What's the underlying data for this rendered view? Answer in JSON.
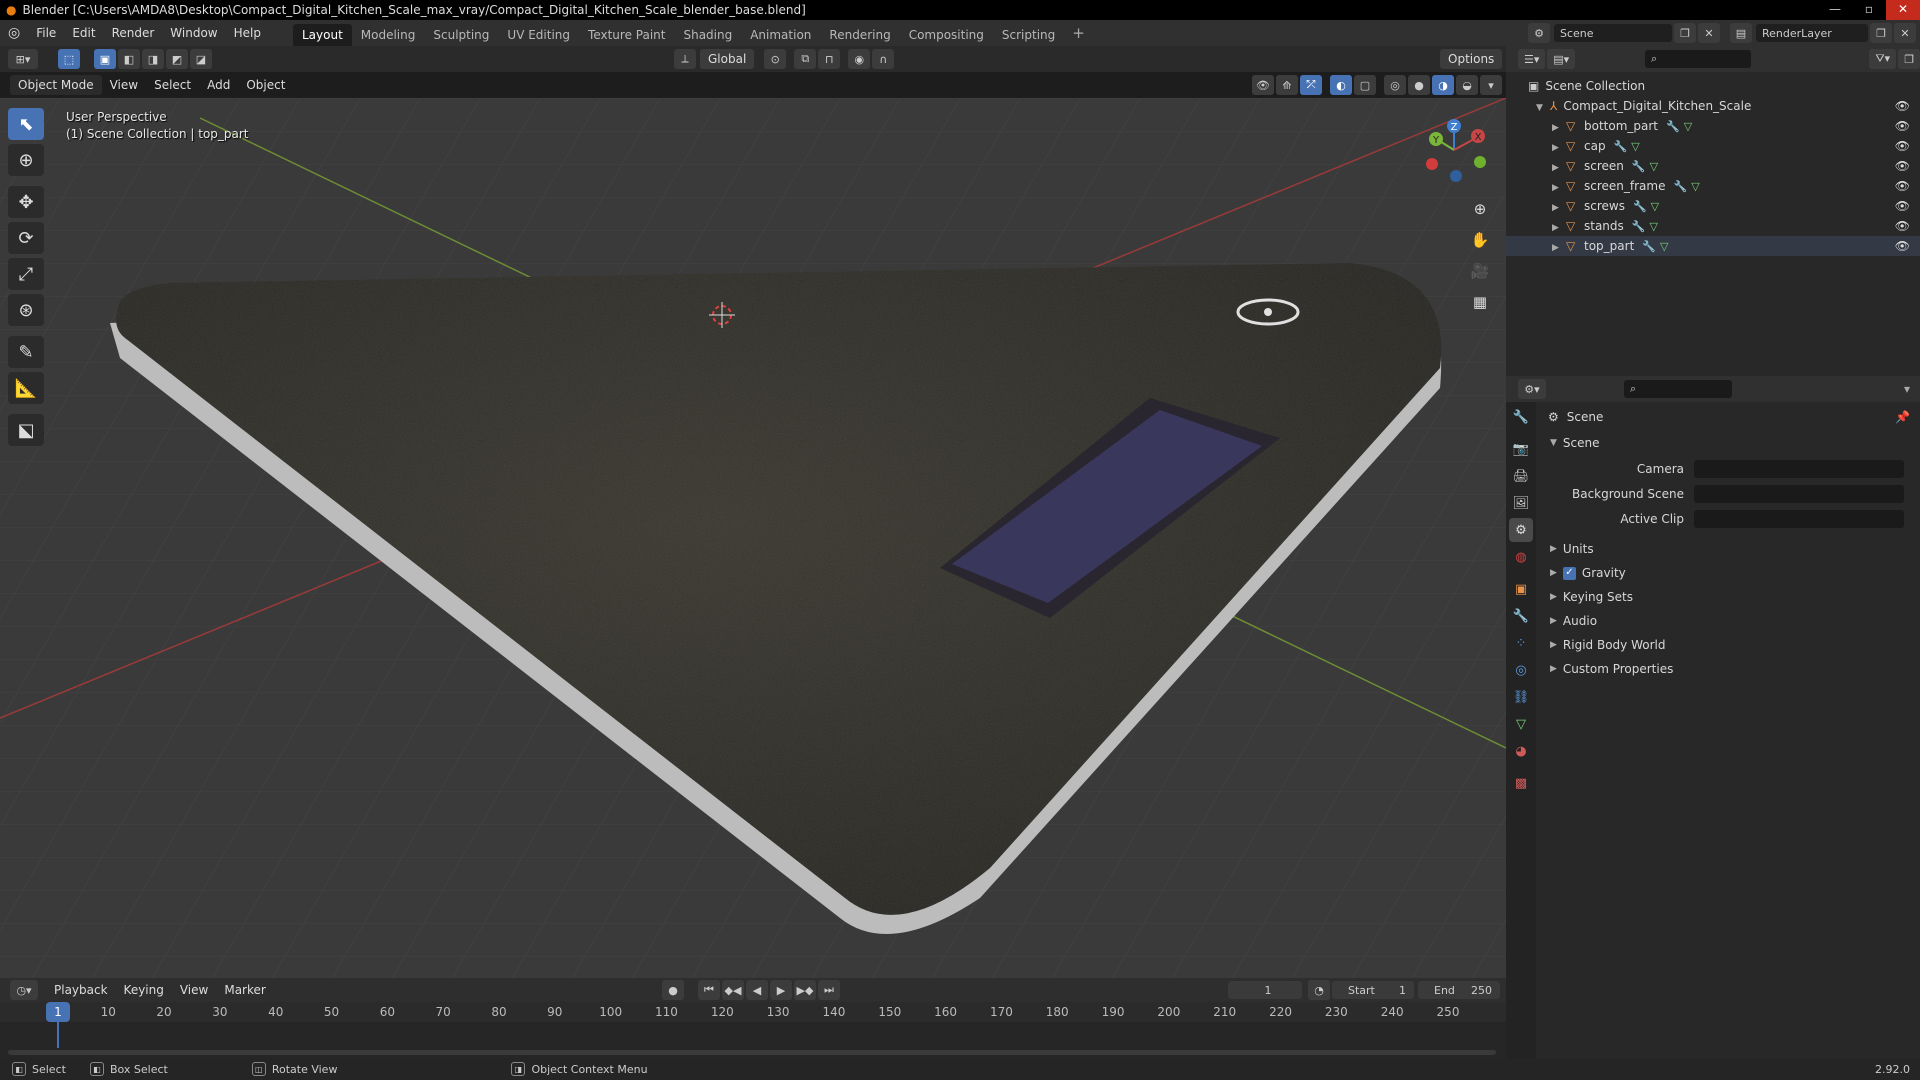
{
  "window": {
    "title": "Blender [C:\\Users\\AMDA8\\Desktop\\Compact_Digital_Kitchen_Scale_max_vray/Compact_Digital_Kitchen_Scale_blender_base.blend]",
    "minimize": "—",
    "maximize": "▫",
    "close": "✕"
  },
  "menu": [
    "File",
    "Edit",
    "Render",
    "Window",
    "Help"
  ],
  "workspaces": [
    "Layout",
    "Modeling",
    "Sculpting",
    "UV Editing",
    "Texture Paint",
    "Shading",
    "Animation",
    "Rendering",
    "Compositing",
    "Scripting"
  ],
  "workspace_add": "+",
  "active_workspace": "Layout",
  "scene_selector": {
    "value": "Scene"
  },
  "renderlayer_selector": {
    "value": "RenderLayer"
  },
  "viewport_header": {
    "transform_orientation": "Global",
    "options": "Options"
  },
  "viewport_menu": {
    "mode": "Object Mode",
    "items": [
      "View",
      "Select",
      "Add",
      "Object"
    ]
  },
  "viewport_overlay": {
    "line1": "User Perspective",
    "line2": "(1) Scene Collection | top_part"
  },
  "gizmo": {
    "x": "X",
    "y": "Y",
    "z": "Z"
  },
  "outliner": {
    "root": "Scene Collection",
    "collection": "Compact_Digital_Kitchen_Scale",
    "objects": [
      "bottom_part",
      "cap",
      "screen",
      "screen_frame",
      "screws",
      "stands",
      "top_part"
    ]
  },
  "properties": {
    "context": "Scene",
    "panel_title": "Scene",
    "fields": [
      {
        "label": "Camera",
        "value": ""
      },
      {
        "label": "Background Scene",
        "value": ""
      },
      {
        "label": "Active Clip",
        "value": ""
      }
    ],
    "sections": [
      "Units",
      "Gravity",
      "Keying Sets",
      "Audio",
      "Rigid Body World",
      "Custom Properties"
    ],
    "gravity_checked": true
  },
  "timeline": {
    "menus": [
      "Playback",
      "Keying",
      "View",
      "Marker"
    ],
    "current_frame": "1",
    "start_label": "Start",
    "start": "1",
    "end_label": "End",
    "end": "250",
    "ticks": [
      "10",
      "20",
      "30",
      "40",
      "50",
      "60",
      "70",
      "80",
      "90",
      "100",
      "110",
      "120",
      "130",
      "140",
      "150",
      "160",
      "170",
      "180",
      "190",
      "200",
      "210",
      "220",
      "230",
      "240",
      "250"
    ],
    "playhead": "1"
  },
  "statusbar": {
    "select": "Select",
    "box_select": "Box Select",
    "rotate_view": "Rotate View",
    "context_menu": "Object Context Menu",
    "version": "2.92.0"
  },
  "colors": {
    "accent": "#4772b3",
    "object_orange": "#e8924a",
    "grid_red": "#b04040",
    "grid_green": "#7aa040"
  }
}
